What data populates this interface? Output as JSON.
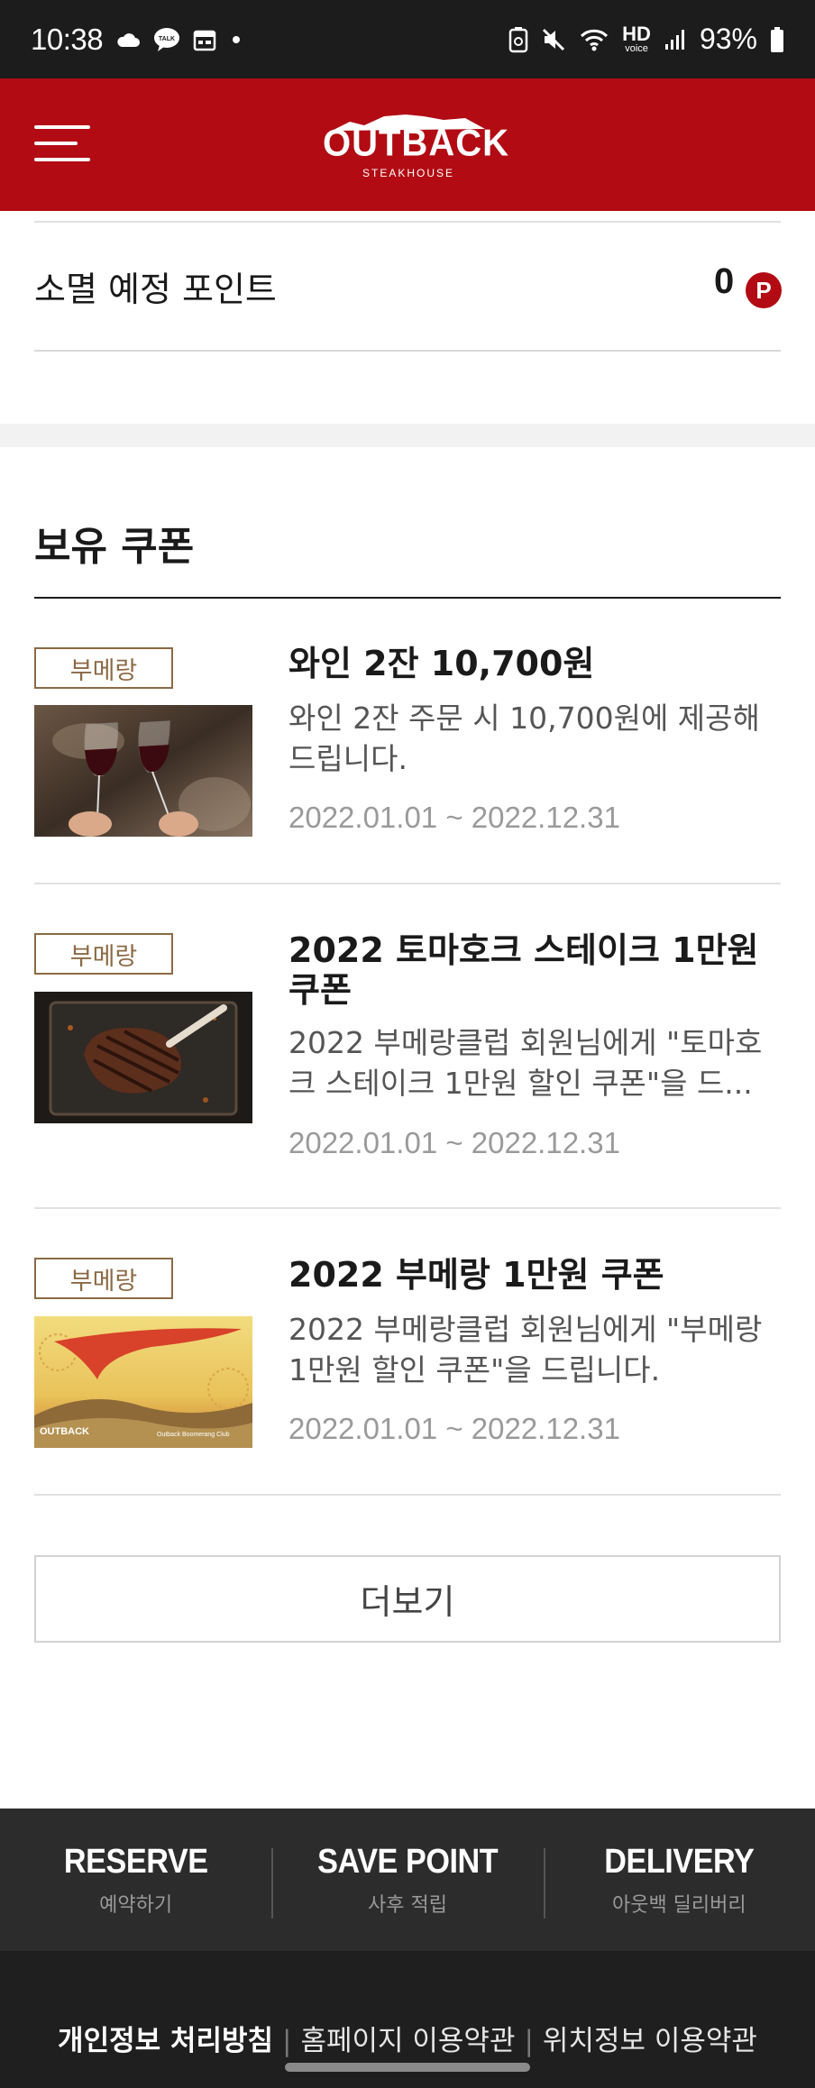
{
  "status_bar": {
    "time": "10:38",
    "battery": "93%",
    "hd_top": "HD",
    "hd_bottom": "voice",
    "icons": [
      "cloud-icon",
      "talk-icon",
      "calendar-icon",
      "dot-icon",
      "battery-saver-icon",
      "mute-icon",
      "wifi-icon",
      "signal-icon",
      "battery-icon"
    ]
  },
  "header": {
    "logo_main": "OUTBACK",
    "logo_sub": "STEAKHOUSE",
    "brand_color": "#b20b13"
  },
  "points": {
    "label": "소멸 예정 포인트",
    "value": "0",
    "badge": "P"
  },
  "coupons": {
    "title": "보유 쿠폰",
    "items": [
      {
        "badge": "부메랑",
        "title": "와인 2잔 10,700원",
        "desc": "와인 2잔 주문 시 10,700원에 제공해 드립니다.",
        "date": "2022.01.01 ~ 2022.12.31",
        "image": "wine-glasses-image"
      },
      {
        "badge": "부메랑",
        "title": "2022 토마호크 스테이크 1만원 쿠폰",
        "desc": "2022 부메랑클럽 회원님에게 \"토마호크 스테이크 1만원 할인 쿠폰\"을 드...",
        "date": "2022.01.01 ~ 2022.12.31",
        "image": "tomahawk-steak-image"
      },
      {
        "badge": "부메랑",
        "title": "2022 부메랑 1만원 쿠폰",
        "desc": "2022 부메랑클럽 회원님에게 \"부메랑 1만원 할인 쿠폰\"을 드립니다.",
        "date": "2022.01.01 ~ 2022.12.31",
        "image": "boomerang-club-image",
        "image_logo": "OUTBACK",
        "image_caption": "Outback Boomerang Club"
      }
    ],
    "more_label": "더보기"
  },
  "footer_nav": [
    {
      "title": "RESERVE",
      "sub": "예약하기"
    },
    {
      "title": "SAVE POINT",
      "sub": "사후 적립"
    },
    {
      "title": "DELIVERY",
      "sub": "아웃백 딜리버리"
    }
  ],
  "footer_links": {
    "privacy": "개인정보 처리방침",
    "terms": "홈페이지 이용약관",
    "location": "위치정보 이용약관"
  }
}
